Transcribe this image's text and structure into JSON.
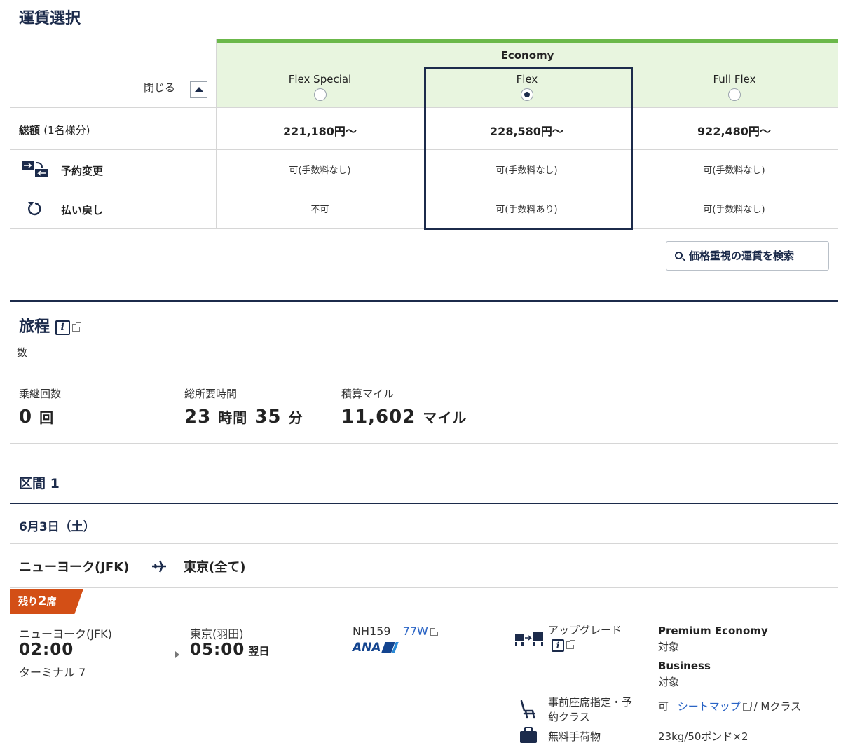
{
  "fare": {
    "title": "運賃選択",
    "cabin": "Economy",
    "close_label": "閉じる",
    "classes": [
      {
        "name": "Flex Special",
        "selected": false,
        "total": "221,180円～",
        "change": "可(手数料なし)",
        "refund": "不可"
      },
      {
        "name": "Flex",
        "selected": true,
        "total": "228,580円～",
        "change": "可(手数料なし)",
        "refund": "可(手数料あり)"
      },
      {
        "name": "Full Flex",
        "selected": false,
        "total": "922,480円～",
        "change": "可(手数料なし)",
        "refund": "可(手数料なし)"
      }
    ],
    "rows": {
      "total_label": "総額",
      "total_sub": "(1名様分)",
      "change_label": "予約変更",
      "refund_label": "払い戻し"
    },
    "search_label": "価格重視の運賃を検索"
  },
  "itinerary": {
    "title": "旅程",
    "fragment": "数",
    "stats": [
      {
        "label": "乗継回数",
        "value": "0",
        "unit": "回"
      },
      {
        "label": "総所要時間",
        "value": "23",
        "unit": "時間",
        "value2": "35",
        "unit2": "分"
      },
      {
        "label": "積算マイル",
        "value": "11,602",
        "unit": "マイル"
      }
    ]
  },
  "segment": {
    "title": "区間 1",
    "date": "6月3日（土）",
    "origin": "ニューヨーク(JFK)",
    "destination": "東京(全て)",
    "seats_prefix": "残り",
    "seats_count": "2",
    "seats_suffix": "席",
    "depart_city": "ニューヨーク(JFK)",
    "depart_time": "02:00",
    "depart_terminal": "ターミナル 7",
    "arrive_city": "東京(羽田)",
    "arrive_time": "05:00",
    "arrive_note": "翌日",
    "flight_no": "NH159",
    "aircraft": "77W",
    "airline_logo": "ANA",
    "upgrade_label": "アップグレード",
    "upgrade_items": [
      {
        "cabin": "Premium Economy",
        "status": "対象"
      },
      {
        "cabin": "Business",
        "status": "対象"
      }
    ],
    "seat_label_1": "事前座席指定・予",
    "seat_label_2": "約クラス",
    "seat_value_prefix": "可",
    "seat_map_link": "シートマップ",
    "seat_value_suffix": "/ Mクラス",
    "baggage_label": "無料手荷物",
    "baggage_value": "23kg/50ポンド×2"
  }
}
